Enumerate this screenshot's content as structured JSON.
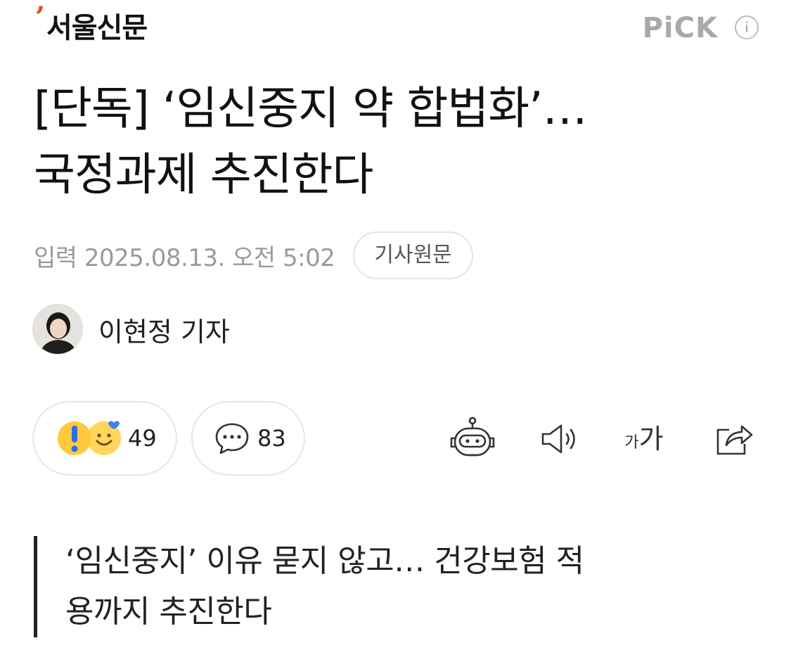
{
  "header": {
    "logo_mark": "’",
    "logo_text": "서울신문",
    "pick_label": "PiCK",
    "info_label": "i"
  },
  "article": {
    "title_line1": "[단독] ‘임신중지 약 합법화’…",
    "title_line2": "국정과제 추진한다",
    "date": "입력 2025.08.13. 오전 5:02",
    "source_button": "기사원문",
    "author": "이현정 기자",
    "subheading_line1": "‘임신중지’ 이유 묻지 않고… 건강보험 적",
    "subheading_line2": "용까지 추진한다"
  },
  "actions": {
    "reaction_count": "49",
    "comment_count": "83",
    "font_small": "가",
    "font_large": "가"
  },
  "icons": {
    "reaction": "reaction-emoji-icon",
    "comment": "comment-bubble-icon",
    "robot": "ai-summary-robot-icon",
    "speaker": "speaker-icon",
    "font": "font-size-icon",
    "share": "share-icon"
  },
  "colors": {
    "logo_accent": "#e8481e",
    "pick": "#a9a9a9",
    "meta_text": "#9a9a9a",
    "reaction_yellow": "#ffc93c",
    "reaction_blue": "#3d7df5"
  }
}
